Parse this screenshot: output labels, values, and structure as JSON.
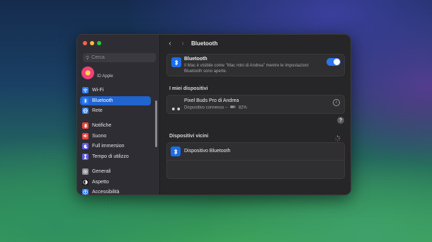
{
  "window": {
    "traffic_lights": [
      "close",
      "minimize",
      "zoom"
    ]
  },
  "sidebar": {
    "search_placeholder": "Cerca",
    "account_label": "ID Apple",
    "groups": [
      [
        {
          "label": "Wi-Fi",
          "icon": "wifi-icon",
          "color": "#2c7cf6",
          "selected": false
        },
        {
          "label": "Bluetooth",
          "icon": "bluetooth-icon",
          "color": "#2c7cf6",
          "selected": true
        },
        {
          "label": "Rete",
          "icon": "globe-icon",
          "color": "#2c7cf6",
          "selected": false
        }
      ],
      [
        {
          "label": "Notifiche",
          "icon": "bell-icon",
          "color": "#f0453a",
          "selected": false
        },
        {
          "label": "Suono",
          "icon": "speaker-icon",
          "color": "#f0453a",
          "selected": false
        },
        {
          "label": "Full immersion",
          "icon": "moon-icon",
          "color": "#5e5ce6",
          "selected": false
        },
        {
          "label": "Tempo di utilizzo",
          "icon": "hourglass-icon",
          "color": "#5e5ce6",
          "selected": false
        }
      ],
      [
        {
          "label": "Generali",
          "icon": "gear-icon",
          "color": "#8e8e93",
          "selected": false
        },
        {
          "label": "Aspetto",
          "icon": "appearance-icon",
          "color": "#1c1c1e",
          "selected": false
        },
        {
          "label": "Accessibilità",
          "icon": "accessibility-icon",
          "color": "#2c7cf6",
          "selected": false
        }
      ]
    ]
  },
  "toolbar": {
    "back_symbol": "‹",
    "forward_symbol": "›",
    "title": "Bluetooth"
  },
  "bluetooth": {
    "title": "Bluetooth",
    "description": "Il Mac è visibile come \"Mac mini di Andrea\" mentre le impostazioni Bluetooth sono aperte.",
    "enabled": true
  },
  "my_devices": {
    "heading": "I miei dispositivi",
    "device_name": "Pixel Buds Pro di Andrea",
    "device_status": "Dispositivo connesso –",
    "battery": "82%"
  },
  "help_symbol": "?",
  "nearby": {
    "heading": "Dispositivi vicini",
    "device_name": "Dispositivo Bluetooth"
  },
  "colors": {
    "accent": "#2163cf",
    "toggle_on": "#2e75ea"
  }
}
